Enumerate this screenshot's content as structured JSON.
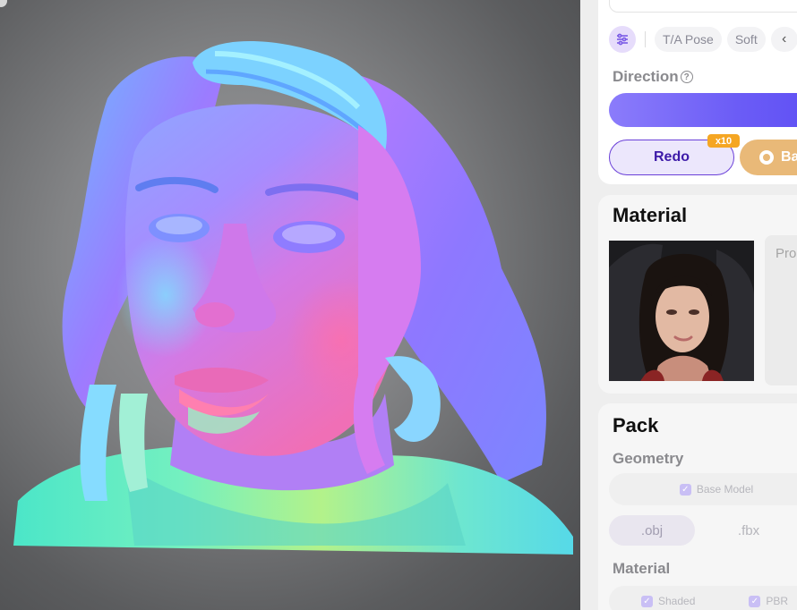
{
  "toolbar": {
    "settings_icon": "sliders-icon",
    "chips": [
      "T/A Pose",
      "Soft"
    ],
    "prev_icon": "chevron-left-icon"
  },
  "direction": {
    "label": "Direction",
    "help_icon": "question-circle-icon"
  },
  "actions": {
    "redo_label": "Redo",
    "redo_badge": "x10",
    "bake_label": "Ba",
    "bake_icon": "paint-splash-icon"
  },
  "material": {
    "title": "Material",
    "prompt_placeholder": "Pro"
  },
  "pack": {
    "title": "Pack",
    "geometry_label": "Geometry",
    "base_model_label": "Base Model",
    "formats": [
      ".obj",
      ".fbx"
    ],
    "material_label": "Material",
    "material_options": [
      "Shaded",
      "PBR"
    ]
  },
  "colors": {
    "accent": "#6b5cf6",
    "bake": "#e9b978",
    "badge": "#f5a623"
  }
}
